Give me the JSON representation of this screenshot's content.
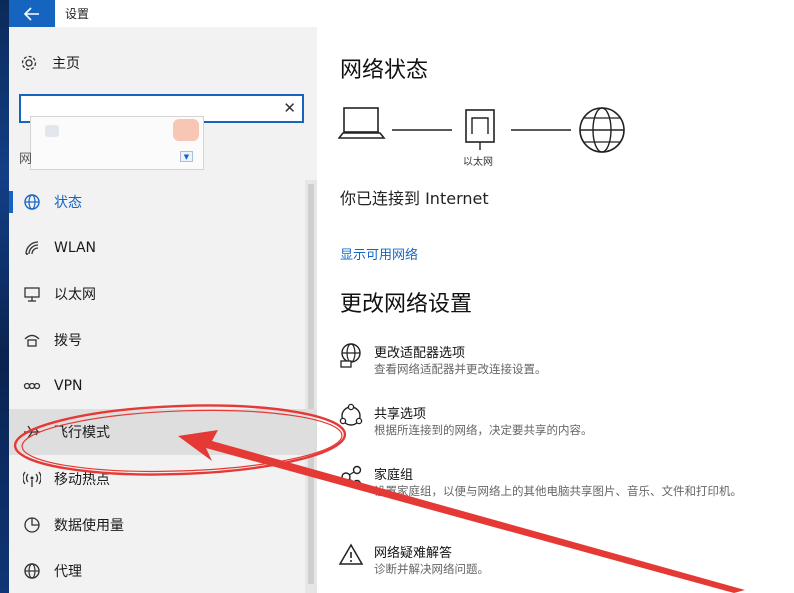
{
  "window": {
    "title": "设置",
    "back_icon": "arrow-left-icon"
  },
  "nav": {
    "home_label": "主页",
    "search_value": "",
    "clipped_heading": "网",
    "items": [
      {
        "label": "状态",
        "icon": "globe-icon",
        "active": true
      },
      {
        "label": "WLAN",
        "icon": "wifi-icon"
      },
      {
        "label": "以太网",
        "icon": "ethernet-icon"
      },
      {
        "label": "拨号",
        "icon": "dialup-icon"
      },
      {
        "label": "VPN",
        "icon": "vpn-icon"
      },
      {
        "label": "飞行模式",
        "icon": "airplane-icon",
        "hovered": true
      },
      {
        "label": "移动热点",
        "icon": "hotspot-icon"
      },
      {
        "label": "数据使用量",
        "icon": "pie-chart-icon"
      },
      {
        "label": "代理",
        "icon": "globe-icon"
      }
    ]
  },
  "main": {
    "status_title": "网络状态",
    "network_label": "以太网",
    "connected_text": "你已连接到 Internet",
    "show_networks_link": "显示可用网络",
    "change_title": "更改网络设置",
    "options": [
      {
        "title": "更改适配器选项",
        "desc": "查看网络适配器并更改连接设置。",
        "icon": "adapter-globe-icon"
      },
      {
        "title": "共享选项",
        "desc": "根据所连接到的网络，决定要共享的内容。",
        "icon": "share-network-icon"
      },
      {
        "title": "家庭组",
        "desc": "设置家庭组，以便与网络上的其他电脑共享图片、音乐、文件和打印机。",
        "icon": "homegroup-icon"
      },
      {
        "title": "网络疑难解答",
        "desc": "诊断并解决网络问题。",
        "icon": "warning-icon"
      }
    ]
  },
  "colors": {
    "accent": "#1565c0",
    "annotation": "#e53935",
    "nav_bg": "#f2f2f2"
  }
}
